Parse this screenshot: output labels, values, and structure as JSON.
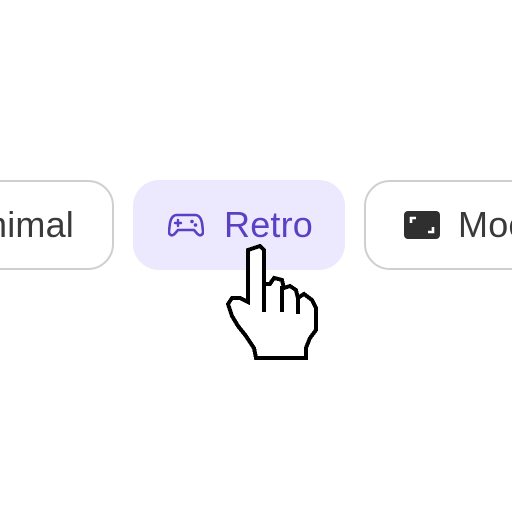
{
  "chips": {
    "left": {
      "label": "nimal",
      "icon": "none"
    },
    "retro": {
      "label": "Retro",
      "icon": "gamepad-icon",
      "selected": true
    },
    "right": {
      "label": "Moc",
      "icon": "screen-corners-icon"
    }
  },
  "cursor": {
    "icon": "pointer-hand-icon"
  },
  "colors": {
    "selected_bg": "#ece8fd",
    "selected_text": "#5b40c4",
    "chip_border": "#cfcfcf",
    "chip_text": "#3a3a3a"
  }
}
